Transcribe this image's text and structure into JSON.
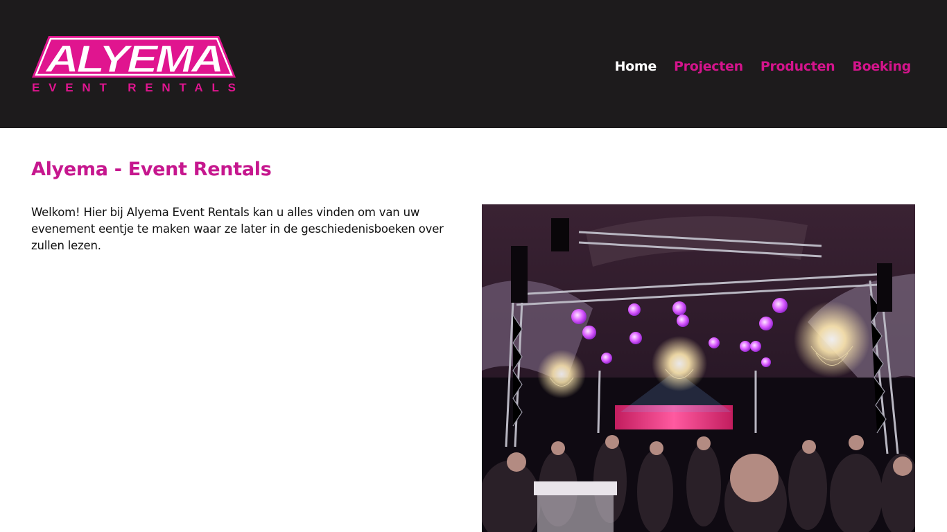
{
  "header": {
    "logo": {
      "wordmark": "ALYEMA",
      "tagline": "EVENT RENTALS",
      "brand_color": "#e0158f"
    },
    "nav": [
      {
        "label": "Home",
        "active": true
      },
      {
        "label": "Projecten",
        "active": false
      },
      {
        "label": "Producten",
        "active": false
      },
      {
        "label": "Boeking",
        "active": false
      }
    ]
  },
  "main": {
    "title": "Alyema - Event Rentals",
    "intro": "Welkom! Hier bij Alyema Event Rentals kan u alles vinden om van uw evenement eentje te maken waar ze later in de geschiedenisboeken over zullen lezen."
  },
  "colors": {
    "header_bg": "#1d1b1c",
    "accent": "#c6178e",
    "nav_active": "#ffffff"
  }
}
